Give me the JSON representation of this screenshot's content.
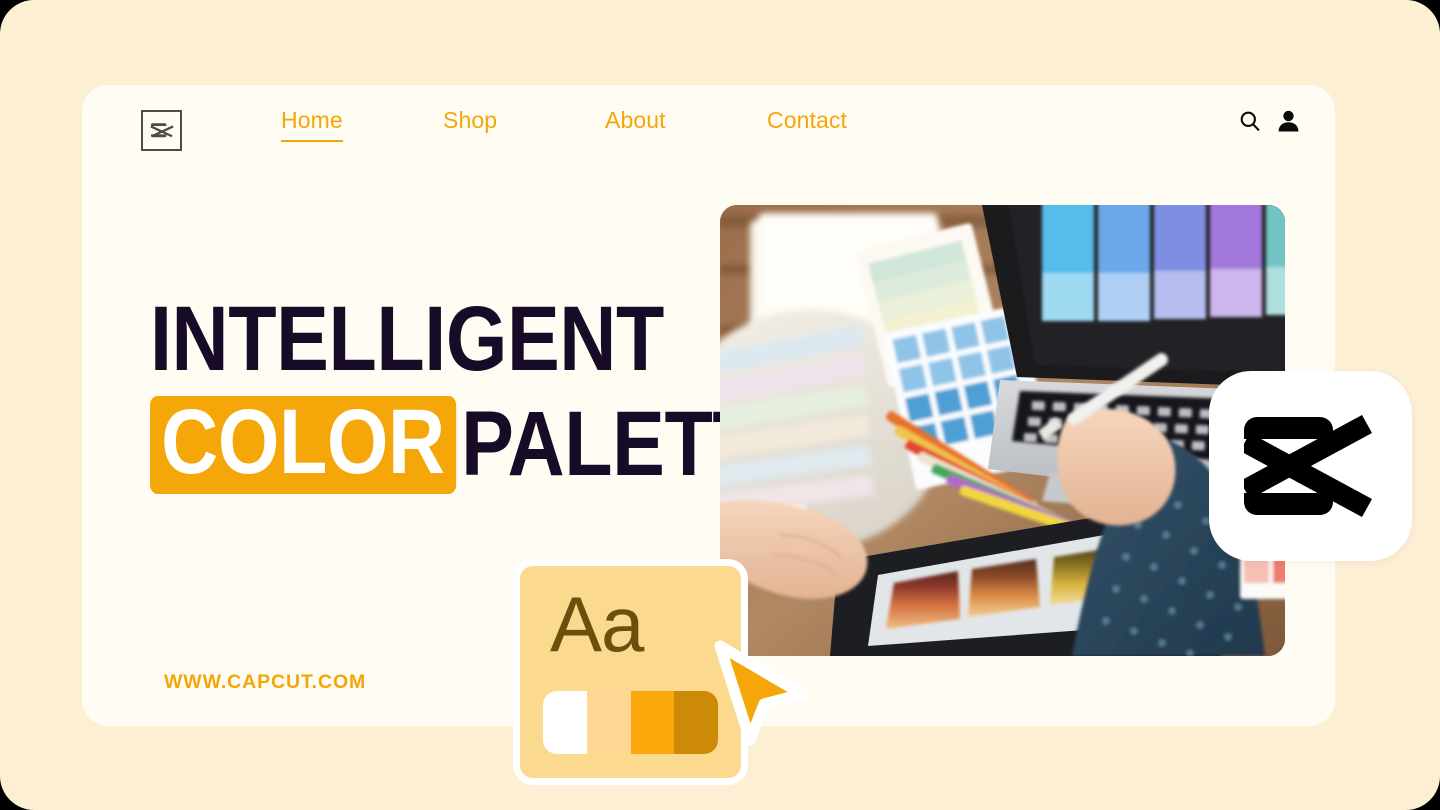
{
  "canvas": {
    "background_color": "#FDEFD3",
    "card_background_color": "#FFFCF4",
    "accent_color": "#F4A609",
    "headline_color": "#180B27"
  },
  "navbar": {
    "logo_name": "capcut-logo",
    "links": [
      {
        "label": "Home",
        "active": true
      },
      {
        "label": "Shop",
        "active": false
      },
      {
        "label": "About",
        "active": false
      },
      {
        "label": "Contact",
        "active": false
      }
    ],
    "actions": [
      {
        "name": "search-icon",
        "label": "Search"
      },
      {
        "name": "account-icon",
        "label": "Account"
      }
    ]
  },
  "hero": {
    "headline_line_1": "INTELLIGENT",
    "headline_highlight": "COLOR",
    "headline_line_2_rest": "PALETTE",
    "highlight_background": "#F5A70A",
    "highlight_text_color": "#FFFFFF",
    "url": "WWW.CAPCUT.COM",
    "photo_alt": "Designer hands using stylus on tablet showing color palette swatches beside laptop, color fan decks and colored pencils"
  },
  "aa_card": {
    "sample_text": "Aa",
    "background_color": "#FBD98E",
    "text_color": "#6B4F0D",
    "border_color": "#FFFFFF",
    "swatches": [
      "#FFFFFF",
      "#FFD694",
      "#FAA80B",
      "#CC8A06"
    ]
  },
  "badge": {
    "name": "capcut-logo-badge",
    "background_color": "#FFFFFF",
    "mark_color": "#000000"
  },
  "cursor": {
    "name": "pointer-cursor",
    "fill_color": "#F5A70A",
    "stroke_color": "#FFFFFF"
  }
}
